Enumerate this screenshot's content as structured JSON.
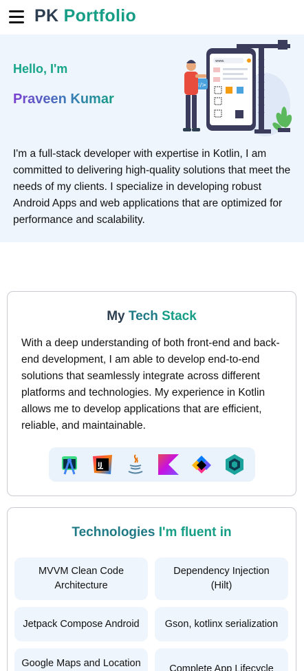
{
  "header": {
    "brand_pk": "PK",
    "brand_portfolio": "Portfolio"
  },
  "hero": {
    "greeting": "Hello, I'm",
    "name": "Praveen Kumar",
    "bio": "I'm a full-stack developer with expertise in Kotlin, I am committed to delivering high-quality solutions that meet the needs of my clients. I specialize in developing robust Android Apps and web applications that are optimized for performance and scalability.",
    "illustration_label": "</>",
    "illustration_url_text": "www."
  },
  "tech_stack": {
    "title_part1": "My",
    "title_part2": "Tech",
    "title_part3": "Stack",
    "description": "With a deep understanding of both front-end and back-end development, I am able to develop end-to-end solutions that seamlessly integrate across different platforms and technologies. My experience in Kotlin allows me to develop applications that are efficient, reliable, and maintainable.",
    "icons": [
      "android-studio-icon",
      "intellij-idea-icon",
      "java-icon",
      "kotlin-icon",
      "jetpack-compose-icon",
      "ktor-icon"
    ],
    "intellij_glyph": "IJ"
  },
  "technologies": {
    "title_part1": "Technologies",
    "title_part2": "I'm fluent in",
    "items": [
      "MVVM Clean Code Architecture",
      "Dependency Injection (Hilt)",
      "Jetpack Compose Android",
      "Gson, kotlinx serialization",
      "Google Maps and Location",
      "Complete App Lifecycle"
    ]
  },
  "colors": {
    "accent_teal": "#169d85",
    "dark_navy": "#2c3e50",
    "hero_bg": "#eef5fc",
    "name_gradient_start": "#7a3fd0"
  }
}
